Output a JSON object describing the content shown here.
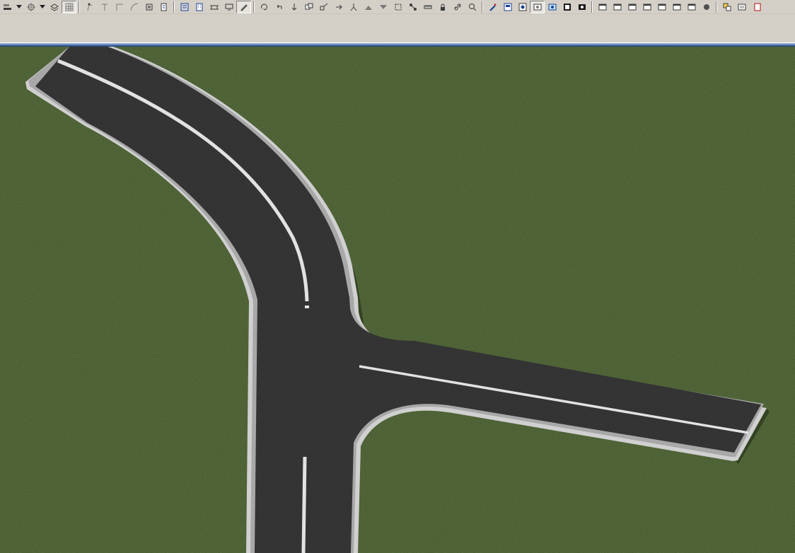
{
  "toolbar": {
    "groups": [
      {
        "id": "grp1",
        "buttons": [
          "align-left-icon",
          "dropdown-arrow-icon",
          "snap-grid-icon",
          "dropdown-arrow-icon",
          "layers-icon",
          "grid-icon"
        ]
      },
      {
        "id": "grp2",
        "buttons": [
          "vertex-tool-icon",
          "line-tool-icon",
          "corner-tool-icon",
          "curve-tool-icon",
          "stack-icon",
          "document-edit-icon"
        ]
      },
      {
        "id": "grp3",
        "buttons": [
          "road-palette-icon",
          "building-icon",
          "bridge-icon",
          "monitor-icon",
          "pencil-edit-icon"
        ]
      },
      {
        "id": "grp4",
        "buttons": [
          "rotate-icon",
          "undo-arrow-icon",
          "move-down-icon",
          "copy-icon",
          "scale-icon",
          "branch-icon",
          "split-icon",
          "terrain-up-icon",
          "terrain-down-icon",
          "select-nodes-icon",
          "connect-icon",
          "measure-icon",
          "lock-icon",
          "link-icon",
          "zoom-extents-icon"
        ]
      },
      {
        "id": "grp5",
        "buttons": [
          "wand-icon",
          "panel-icon",
          "view-icon",
          "camera-rotate-icon",
          "camera-orbit-icon",
          "filmstrip-icon",
          "photo-icon"
        ]
      },
      {
        "id": "grp6",
        "buttons": [
          "window-icon",
          "window-home-icon",
          "window-settings-icon",
          "window-formula-icon",
          "window-group-icon",
          "window-list-icon",
          "window-record-icon",
          "stop-icon"
        ]
      },
      {
        "id": "grp7",
        "buttons": [
          "properties-icon",
          "close-panels-icon",
          "more-icon"
        ]
      }
    ],
    "pressed_buttons": [
      "grid-icon",
      "pencil-edit-icon",
      "camera-rotate-icon"
    ]
  },
  "viewport": {
    "scene": "road-intersection-3d",
    "colors": {
      "grass": "#3d5025",
      "asphalt": "#262626",
      "curb_top": "#a8a8a8",
      "curb_side": "#d0d0d0",
      "lane_marking": "#e2e2e2",
      "shadow": "#1e2a12"
    }
  }
}
